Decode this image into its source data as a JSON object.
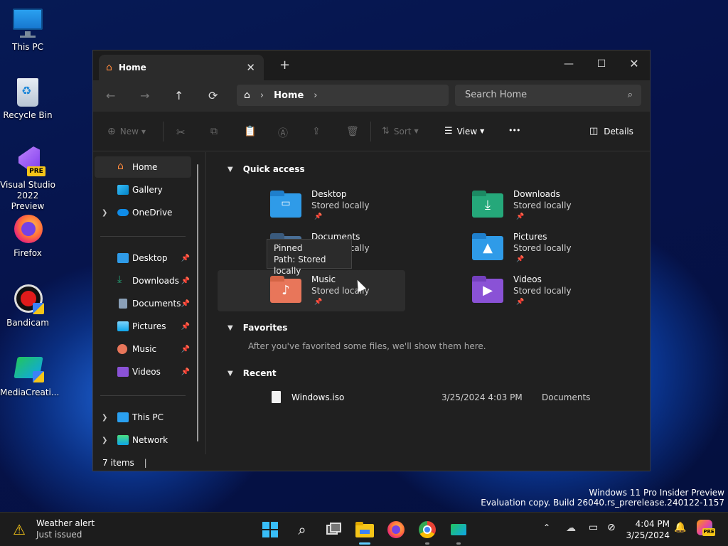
{
  "desktop": {
    "icons": [
      {
        "label": "This PC"
      },
      {
        "label": "Recycle Bin"
      },
      {
        "label": "Visual Studio 2022 Preview"
      },
      {
        "label": "Firefox"
      },
      {
        "label": "Bandicam"
      },
      {
        "label": "MediaCreati..."
      }
    ],
    "vs_badge": "PRE"
  },
  "window": {
    "tab_title": "Home",
    "tab_close": "✕",
    "new_tab": "+",
    "controls": {
      "minimize": "—",
      "maximize": "☐",
      "close": "✕"
    },
    "nav": {
      "back": "←",
      "forward": "→",
      "up": "↑",
      "refresh": "⟳"
    },
    "breadcrumb": {
      "crumb": "Home",
      "sep": "›"
    },
    "search": {
      "placeholder": "Search Home"
    },
    "commands": {
      "new": "New",
      "sort": "Sort",
      "view": "View",
      "more": "•••",
      "details": "Details"
    },
    "sidebar": {
      "items": [
        {
          "label": "Home"
        },
        {
          "label": "Gallery"
        },
        {
          "label": "OneDrive"
        },
        {
          "label": "Desktop"
        },
        {
          "label": "Downloads"
        },
        {
          "label": "Documents"
        },
        {
          "label": "Pictures"
        },
        {
          "label": "Music"
        },
        {
          "label": "Videos"
        },
        {
          "label": "This PC"
        },
        {
          "label": "Network"
        }
      ]
    },
    "quick_access": {
      "title": "Quick access",
      "folders": [
        {
          "name": "Desktop",
          "status": "Stored locally"
        },
        {
          "name": "Downloads",
          "status": "Stored locally"
        },
        {
          "name": "Documents",
          "status": "Stored locally"
        },
        {
          "name": "Pictures",
          "status": "Stored locally"
        },
        {
          "name": "Music",
          "status": "Stored locally"
        },
        {
          "name": "Videos",
          "status": "Stored locally"
        }
      ]
    },
    "tooltip": {
      "line1": "Pinned",
      "line2": "Path: Stored locally"
    },
    "favorites": {
      "title": "Favorites",
      "empty": "After you've favorited some files, we'll show them here."
    },
    "recent": {
      "title": "Recent",
      "files": [
        {
          "name": "Windows.iso",
          "date": "3/25/2024 4:03 PM",
          "location": "Documents"
        }
      ]
    },
    "status": "7 items"
  },
  "watermark": {
    "line1": "Windows 11 Pro Insider Preview",
    "line2": "Evaluation copy. Build 26040.rs_prerelease.240122-1157"
  },
  "taskbar": {
    "weather": {
      "title": "Weather alert",
      "sub": "Just issued"
    },
    "time": "4:04 PM",
    "date": "3/25/2024",
    "copilot_badge": "PRE"
  },
  "colors": {
    "accent": "#60cdff",
    "folder_blue": "#2f9be8",
    "folder_green": "#25a87a",
    "folder_music": "#e8765a",
    "folder_video": "#8a52d6"
  }
}
